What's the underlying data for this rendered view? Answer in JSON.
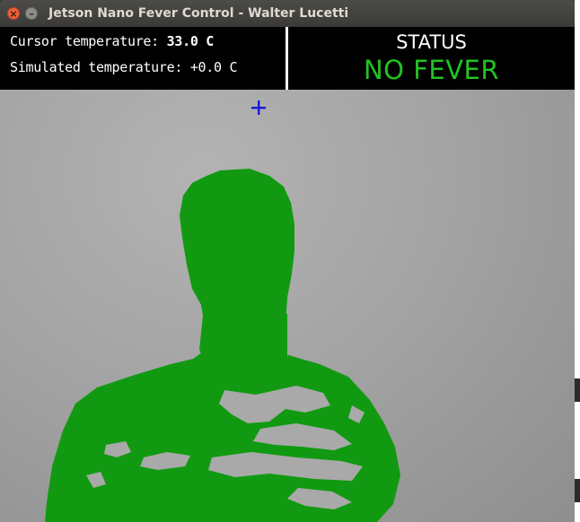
{
  "window": {
    "title": "Jetson Nano Fever Control - Walter Lucetti",
    "close_glyph": "×",
    "minimize_glyph": "–"
  },
  "info": {
    "cursor_label": "Cursor temperature: ",
    "cursor_value": "33.0 C",
    "simulated_label": "Simulated temperature: ",
    "simulated_value": "+0.0 C"
  },
  "status": {
    "title": "STATUS",
    "value": "NO FEVER",
    "color": "#22c322"
  },
  "crosshair": {
    "icon": "crosshair-icon",
    "color": "#1a1ad6"
  },
  "overlay": {
    "color": "#119a11"
  }
}
